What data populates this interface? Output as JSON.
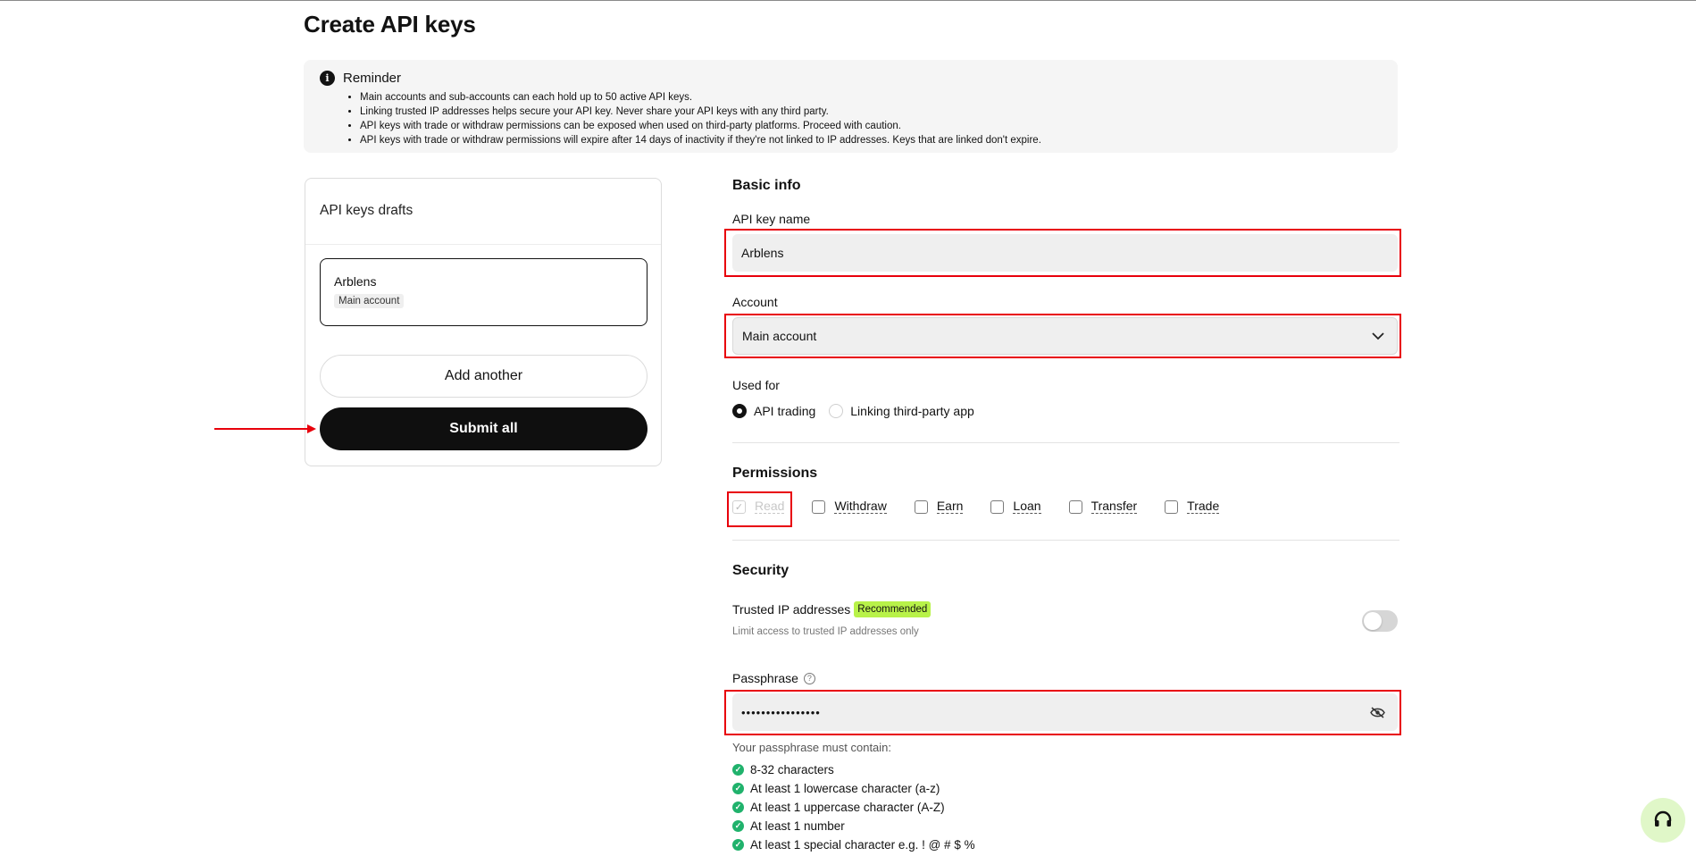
{
  "page": {
    "title": "Create API keys"
  },
  "reminder": {
    "title": "Reminder",
    "items": [
      "Main accounts and sub-accounts can each hold up to 50 active API keys.",
      "Linking trusted IP addresses helps secure your API key. Never share your API keys with any third party.",
      "API keys with trade or withdraw permissions can be exposed when used on third-party platforms. Proceed with caution.",
      "API keys with trade or withdraw permissions will expire after 14 days of inactivity if they're not linked to IP addresses. Keys that are linked don't expire."
    ]
  },
  "drafts": {
    "title": "API keys drafts",
    "card": {
      "name": "Arblens",
      "account": "Main account"
    },
    "add_label": "Add another",
    "submit_label": "Submit all"
  },
  "form": {
    "basic_info_title": "Basic info",
    "api_key_name_label": "API key name",
    "api_key_name_value": "Arblens",
    "account_label": "Account",
    "account_value": "Main account",
    "used_for_label": "Used for",
    "used_for_options": [
      "API trading",
      "Linking third-party app"
    ],
    "used_for_selected": "API trading",
    "permissions_title": "Permissions",
    "permissions": [
      "Read",
      "Withdraw",
      "Earn",
      "Loan",
      "Transfer",
      "Trade"
    ],
    "permission_read_checked": true,
    "security_title": "Security",
    "trusted_ip_label": "Trusted IP addresses",
    "trusted_ip_badge": "Recommended",
    "trusted_ip_desc": "Limit access to trusted IP addresses only",
    "trusted_ip_enabled": false,
    "passphrase_label": "Passphrase",
    "passphrase_value": "••••••••••••••••",
    "passphrase_rules_title": "Your passphrase must contain:",
    "passphrase_rules": [
      "8-32 characters",
      "At least 1 lowercase character (a-z)",
      "At least 1 uppercase character (A-Z)",
      "At least 1 number",
      "At least 1 special character e.g. ! @ # $ %"
    ]
  },
  "colors": {
    "highlight": "#e8000b",
    "accent_badge": "#b8f249",
    "check_green": "#20b26c"
  }
}
